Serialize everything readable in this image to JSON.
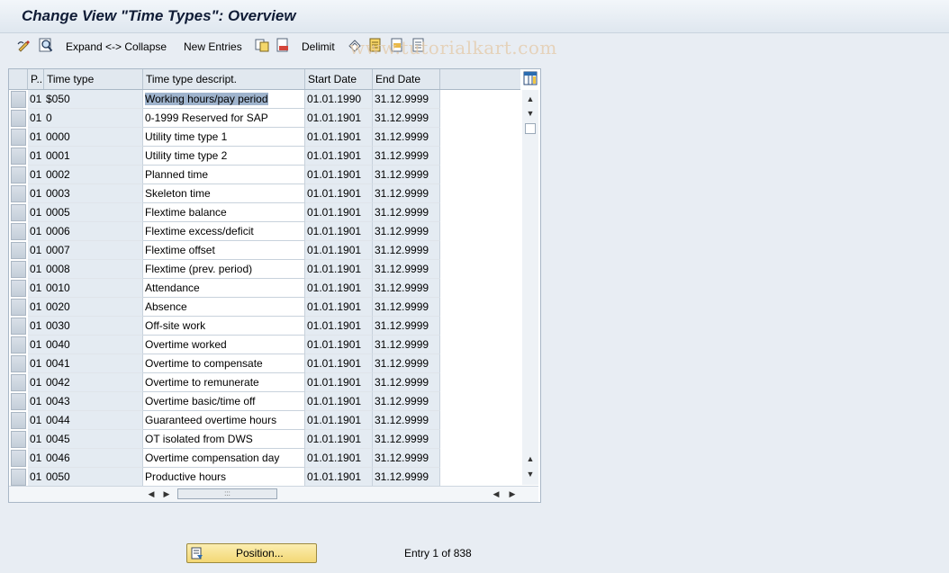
{
  "window": {
    "title": "Change View \"Time Types\": Overview"
  },
  "toolbar": {
    "expand_label": "Expand <-> Collapse",
    "new_entries_label": "New Entries",
    "delimit_label": "Delimit"
  },
  "watermark": "www.tutorialkart.com",
  "table": {
    "columns": [
      "P..",
      "Time type",
      "Time type descript.",
      "Start Date",
      "End Date"
    ],
    "rows": [
      {
        "p": "01",
        "time_type": "$050",
        "desc": "Working hours/pay period",
        "start": "01.01.1990",
        "end": "31.12.9999"
      },
      {
        "p": "01",
        "time_type": "0",
        "desc": "0-1999 Reserved for SAP",
        "start": "01.01.1901",
        "end": "31.12.9999"
      },
      {
        "p": "01",
        "time_type": "0000",
        "desc": "Utility time type 1",
        "start": "01.01.1901",
        "end": "31.12.9999"
      },
      {
        "p": "01",
        "time_type": "0001",
        "desc": "Utility time type 2",
        "start": "01.01.1901",
        "end": "31.12.9999"
      },
      {
        "p": "01",
        "time_type": "0002",
        "desc": "Planned time",
        "start": "01.01.1901",
        "end": "31.12.9999"
      },
      {
        "p": "01",
        "time_type": "0003",
        "desc": "Skeleton time",
        "start": "01.01.1901",
        "end": "31.12.9999"
      },
      {
        "p": "01",
        "time_type": "0005",
        "desc": "Flextime balance",
        "start": "01.01.1901",
        "end": "31.12.9999"
      },
      {
        "p": "01",
        "time_type": "0006",
        "desc": "Flextime excess/deficit",
        "start": "01.01.1901",
        "end": "31.12.9999"
      },
      {
        "p": "01",
        "time_type": "0007",
        "desc": "Flextime offset",
        "start": "01.01.1901",
        "end": "31.12.9999"
      },
      {
        "p": "01",
        "time_type": "0008",
        "desc": "Flextime (prev. period)",
        "start": "01.01.1901",
        "end": "31.12.9999"
      },
      {
        "p": "01",
        "time_type": "0010",
        "desc": "Attendance",
        "start": "01.01.1901",
        "end": "31.12.9999"
      },
      {
        "p": "01",
        "time_type": "0020",
        "desc": "Absence",
        "start": "01.01.1901",
        "end": "31.12.9999"
      },
      {
        "p": "01",
        "time_type": "0030",
        "desc": "Off-site work",
        "start": "01.01.1901",
        "end": "31.12.9999"
      },
      {
        "p": "01",
        "time_type": "0040",
        "desc": "Overtime worked",
        "start": "01.01.1901",
        "end": "31.12.9999"
      },
      {
        "p": "01",
        "time_type": "0041",
        "desc": "Overtime to compensate",
        "start": "01.01.1901",
        "end": "31.12.9999"
      },
      {
        "p": "01",
        "time_type": "0042",
        "desc": "Overtime to remunerate",
        "start": "01.01.1901",
        "end": "31.12.9999"
      },
      {
        "p": "01",
        "time_type": "0043",
        "desc": "Overtime basic/time off",
        "start": "01.01.1901",
        "end": "31.12.9999"
      },
      {
        "p": "01",
        "time_type": "0044",
        "desc": "Guaranteed overtime hours",
        "start": "01.01.1901",
        "end": "31.12.9999"
      },
      {
        "p": "01",
        "time_type": "0045",
        "desc": "OT isolated from DWS",
        "start": "01.01.1901",
        "end": "31.12.9999"
      },
      {
        "p": "01",
        "time_type": "0046",
        "desc": "Overtime compensation day",
        "start": "01.01.1901",
        "end": "31.12.9999"
      },
      {
        "p": "01",
        "time_type": "0050",
        "desc": "Productive hours",
        "start": "01.01.1901",
        "end": "31.12.9999"
      }
    ]
  },
  "footer": {
    "position_label": "Position...",
    "entry_text": "Entry 1 of 838"
  },
  "colors": {
    "accent": "#f3d774",
    "header": "#e1e8ef",
    "selected": "#9fb4cd"
  }
}
